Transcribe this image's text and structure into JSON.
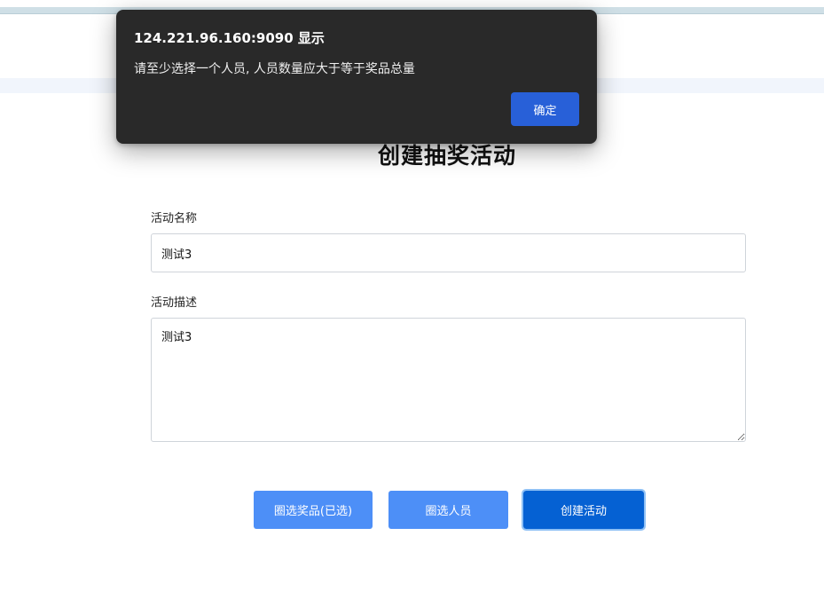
{
  "dialog": {
    "title": "124.221.96.160:9090 显示",
    "message": "请至少选择一个人员, 人员数量应大于等于奖品总量",
    "ok_label": "确定"
  },
  "form": {
    "title": "创建抽奖活动",
    "name_label": "活动名称",
    "name_value": "测试3",
    "desc_label": "活动描述",
    "desc_value": "测试3"
  },
  "actions": {
    "select_prizes_label": "圈选奖品(已选)",
    "select_people_label": "圈选人员",
    "create_label": "创建活动"
  },
  "colors": {
    "primary_light": "#4d8ff7",
    "primary_dark": "#0561d3",
    "dialog_bg": "#292929",
    "dialog_button": "#2860d8"
  }
}
